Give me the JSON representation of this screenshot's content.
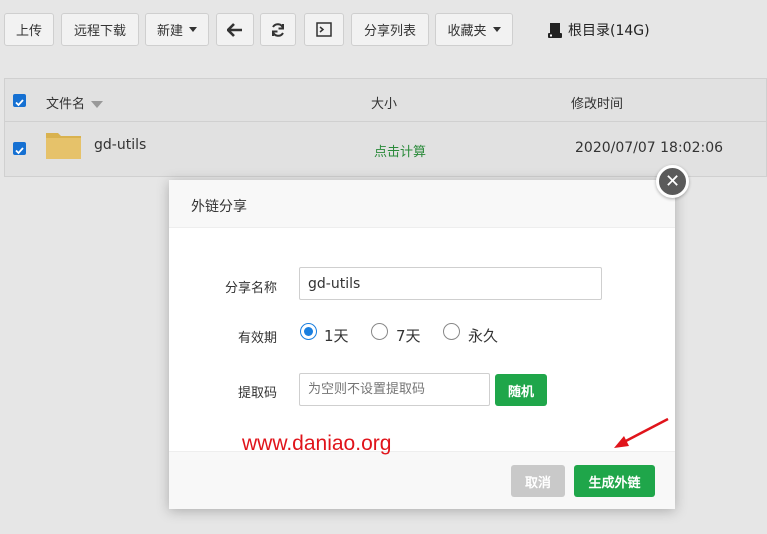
{
  "toolbar": {
    "upload": "上传",
    "remote_download": "远程下载",
    "new": "新建",
    "share_list": "分享列表",
    "favorites": "收藏夹",
    "root_label": "根目录(14G)"
  },
  "table": {
    "headers": {
      "name": "文件名",
      "size": "大小",
      "modified": "修改时间"
    },
    "rows": [
      {
        "name": "gd-utils",
        "size": "点击计算",
        "modified": "2020/07/07 18:02:06"
      }
    ]
  },
  "modal": {
    "title": "外链分享",
    "share_name_label": "分享名称",
    "share_name_value": "gd-utils",
    "validity_label": "有效期",
    "options": [
      "1天",
      "7天",
      "永久"
    ],
    "selected_option": "1天",
    "code_label": "提取码",
    "code_placeholder": "为空则不设置提取码",
    "random_label": "随机",
    "cancel_label": "取消",
    "generate_label": "生成外链"
  },
  "watermark": "www.daniao.org",
  "colors": {
    "primary_green": "#1fa64a",
    "checkbox_blue": "#1570d2",
    "annotation_red": "#e0141b",
    "size_link_green": "#2a8a3a"
  }
}
